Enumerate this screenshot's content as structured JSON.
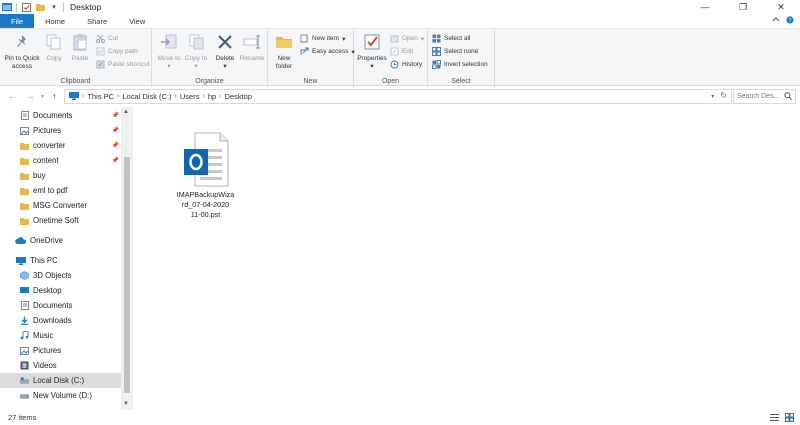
{
  "window": {
    "title": "Desktop",
    "qat_dropdown": "▾",
    "minimize": "—",
    "maximize": "❐",
    "close": "✕"
  },
  "tabs": [
    {
      "label": "File"
    },
    {
      "label": "Home"
    },
    {
      "label": "Share"
    },
    {
      "label": "View"
    }
  ],
  "ribbon": {
    "clipboard": {
      "label": "Clipboard",
      "pin": "Pin to Quick access",
      "copy": "Copy",
      "paste": "Paste",
      "cut": "Cut",
      "copy_path": "Copy path",
      "paste_shortcut": "Paste shortcut"
    },
    "organize": {
      "label": "Organize",
      "move_to": "Move to",
      "copy_to": "Copy to",
      "delete": "Delete",
      "rename": "Rename"
    },
    "new": {
      "label": "New",
      "new_folder": "New folder",
      "new_item": "New item",
      "easy_access": "Easy access"
    },
    "open": {
      "label": "Open",
      "properties": "Properties",
      "open": "Open",
      "edit": "Edit",
      "history": "History"
    },
    "select": {
      "label": "Select",
      "select_all": "Select all",
      "select_none": "Select none",
      "invert": "Invert selection"
    }
  },
  "address": {
    "crumbs": [
      "This PC",
      "Local Disk (C:)",
      "Users",
      "hp",
      "Desktop"
    ],
    "search_placeholder": "Search Des..."
  },
  "nav": {
    "quick_access": [
      {
        "label": "Documents",
        "pinned": true
      },
      {
        "label": "Pictures",
        "pinned": true
      },
      {
        "label": "converter",
        "pinned": true
      },
      {
        "label": "content",
        "pinned": true
      },
      {
        "label": "buy",
        "pinned": false
      },
      {
        "label": "eml to pdf",
        "pinned": false
      },
      {
        "label": "MSG Converter",
        "pinned": false
      },
      {
        "label": "Onetime Soft",
        "pinned": false
      }
    ],
    "onedrive": "OneDrive",
    "this_pc": "This PC",
    "pc_items": [
      "3D Objects",
      "Desktop",
      "Documents",
      "Downloads",
      "Music",
      "Pictures",
      "Videos",
      "Local Disk (C:)",
      "New Volume (D:)"
    ]
  },
  "files": [
    {
      "name": "IMAPBackupWizard_07-04-2020 11-00.pst",
      "name_lines": [
        "IMAPBackupWiza",
        "rd_07-04-2020",
        "11-00.pst"
      ],
      "icon": "outlook-data-file-icon"
    }
  ],
  "status": {
    "item_count": "27 items"
  },
  "colors": {
    "file_tab": "#1979ca",
    "folder": "#e8b94a",
    "outlook_blue": "#0f64b4"
  }
}
